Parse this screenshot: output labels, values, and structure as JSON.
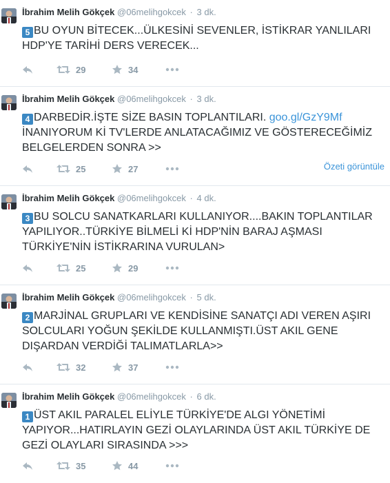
{
  "tweets": [
    {
      "name": "İbrahim Melih Gökçek",
      "handle": "@06melihgokcek",
      "time": "3 dk.",
      "badge": "5",
      "text": "BU OYUN BİTECEK...ÜLKESİNİ SEVENLER, İSTİKRAR YANLILARI HDP'YE TARİHİ DERS VERECEK...",
      "link": "",
      "text_after_link": "",
      "retweets": "29",
      "favorites": "34",
      "summary": ""
    },
    {
      "name": "İbrahim Melih Gökçek",
      "handle": "@06melihgokcek",
      "time": "3 dk.",
      "badge": "4",
      "text": "DARBEDİR.İŞTE SİZE BASIN TOPLANTILARI. ",
      "link": "goo.gl/GzY9Mf",
      "text_after_link": " İNANIYORUM Kİ TV'LERDE ANLATACAĞIMIZ VE GÖSTERECEĞİMİZ BELGELERDEN SONRA >>",
      "retweets": "25",
      "favorites": "27",
      "summary": "Özeti görüntüle"
    },
    {
      "name": "İbrahim Melih Gökçek",
      "handle": "@06melihgokcek",
      "time": "4 dk.",
      "badge": "3",
      "text": "BU SOLCU SANATKARLARI KULLANIYOR....BAKIN TOPLANTILAR YAPILIYOR..TÜRKİYE BİLMELİ Kİ HDP'NİN BARAJ AŞMASI TÜRKİYE'NİN İSTİKRARINA VURULAN>",
      "link": "",
      "text_after_link": "",
      "retweets": "25",
      "favorites": "29",
      "summary": ""
    },
    {
      "name": "İbrahim Melih Gökçek",
      "handle": "@06melihgokcek",
      "time": "5 dk.",
      "badge": "2",
      "text": "MARJİNAL GRUPLARI VE KENDİSİNE SANATÇI ADI VEREN AŞIRI SOLCULARI YOĞUN ŞEKİLDE KULLANMIŞTI.ÜST AKIL GENE DIŞARDAN VERDİĞİ TALIMATLARLA>>",
      "link": "",
      "text_after_link": "",
      "retweets": "32",
      "favorites": "37",
      "summary": ""
    },
    {
      "name": "İbrahim Melih Gökçek",
      "handle": "@06melihgokcek",
      "time": "6 dk.",
      "badge": "1",
      "text": "ÜST AKIL PARALEL ELİYLE TÜRKİYE'DE ALGI YÖNETİMİ YAPIYOR...HATIRLAYIN GEZİ OLAYLARINDA ÜST AKIL TÜRKİYE DE GEZİ OLAYLARI SIRASINDA >>>",
      "link": "",
      "text_after_link": "",
      "retweets": "35",
      "favorites": "44",
      "summary": ""
    }
  ],
  "icons": {
    "reply": "reply-icon",
    "retweet": "retweet-icon",
    "favorite": "star-icon",
    "more": "more-icon"
  },
  "colors": {
    "name": "#292f33",
    "meta": "#8899a6",
    "link": "#3b94d9",
    "badge": "#3b88c3",
    "divider": "#e1e8ed"
  }
}
